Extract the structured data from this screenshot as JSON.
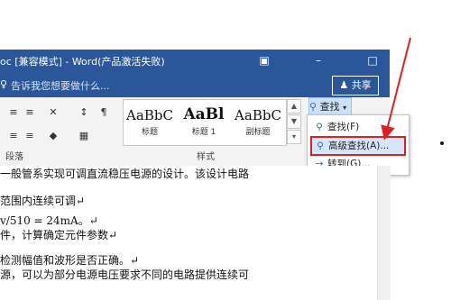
{
  "window": {
    "title": "oc [兼容模式] - Word(产品激活失败)",
    "icons": [
      "ribbon-display-icon",
      "minimize-icon",
      "restore-icon",
      "close-icon"
    ]
  },
  "tellme": {
    "placeholder": "告诉我您想要做什么...",
    "share_label": "共享"
  },
  "ribbon": {
    "groups": {
      "paragraph": "段落",
      "styles": "样式"
    },
    "styles": [
      {
        "sample": "AaBbC",
        "name": "标题"
      },
      {
        "sample": "AaBl",
        "name": "标题 1"
      },
      {
        "sample": "AaBbC",
        "name": "副标题"
      }
    ]
  },
  "find": {
    "button_label": "查找",
    "menu": [
      {
        "label": "查找(F)",
        "icon": "search-icon"
      },
      {
        "label": "高级查找(A)...",
        "icon": "search-icon"
      },
      {
        "label": "转到(G)...",
        "icon": "arrow-right-icon"
      }
    ]
  },
  "document": {
    "lines": [
      "一般管系实现可调直流稳压电源的设计。该设计电路",
      "范围内连续可调↵",
      "v/510   =   24mA。↵",
      "件，计算确定元件参数↵",
      "检测幅值和波形是否正确。↵",
      "源，可以为部分电源电压要求不同的电路提供连续可"
    ]
  },
  "colors": {
    "titlebar": "#2b579a",
    "highlight_box": "#e02020",
    "arrow": "#e02020"
  }
}
